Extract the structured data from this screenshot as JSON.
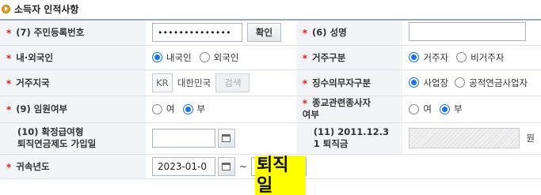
{
  "section": {
    "title": "소득자 인적사항"
  },
  "rows": {
    "resident_no": {
      "label": "(7) 주민등록번호",
      "value": "••••••••••••••",
      "confirm_button": "확인"
    },
    "name": {
      "label": "(6) 성명",
      "value": ""
    },
    "nationality": {
      "label": "내·외국인",
      "options": [
        "내국인",
        "외국인"
      ],
      "selected": "내국인"
    },
    "residence_type": {
      "label": "거주구분",
      "options": [
        "거주자",
        "비거주자"
      ],
      "selected": "거주자"
    },
    "residence_region": {
      "label": "거주지국",
      "code": "KR",
      "country": "대한민국",
      "search_button": "검색"
    },
    "withholding_type": {
      "label": "징수의무자구분",
      "options": [
        "사업장",
        "공적연금사업자"
      ],
      "selected": "사업장"
    },
    "executive": {
      "label": "(9) 임원여부",
      "options": [
        "여",
        "부"
      ],
      "selected": "부"
    },
    "religious": {
      "label_line1": "종교관련종사자",
      "label_line2": "여부",
      "options": [
        "여",
        "부"
      ],
      "selected": "부"
    },
    "defined_benefit": {
      "label_line1": "(10) 확정급여형",
      "label_line2": "퇴직연금제도 가입일",
      "value": ""
    },
    "retirement_pay": {
      "label_line1": "(11) 2011.12.3",
      "label_line2": "1 퇴직금",
      "unit": "원"
    },
    "attribution_year": {
      "label": "귀속년도",
      "start": "2023-01-0",
      "separator": "~",
      "end_highlight": "퇴직일"
    }
  }
}
